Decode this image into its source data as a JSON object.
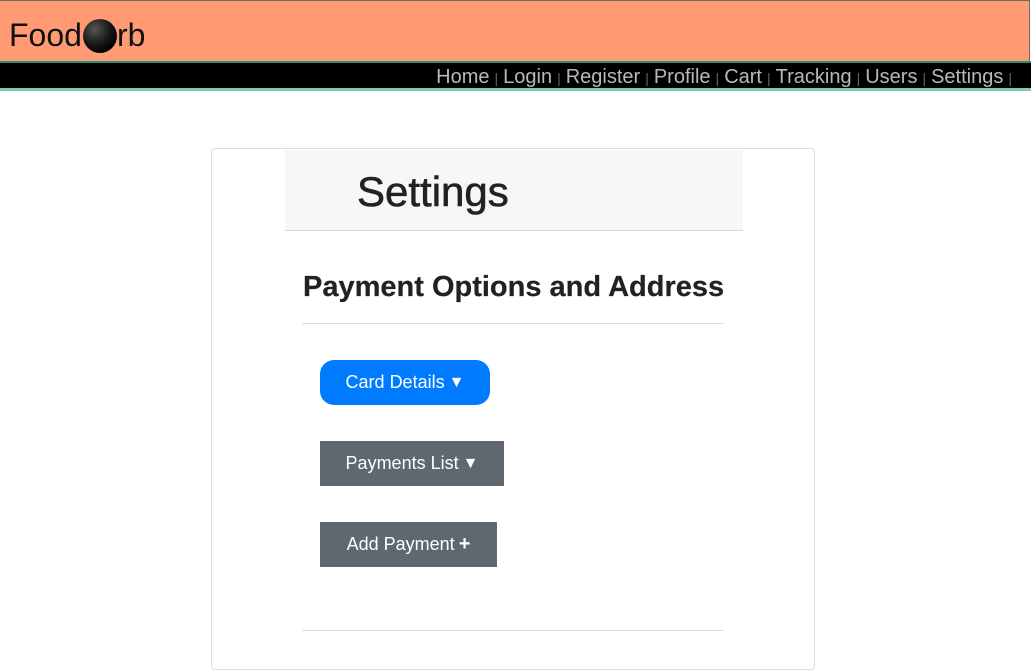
{
  "header": {
    "brand_prefix": "Food",
    "brand_suffix": "rb",
    "brand_colors": {
      "background": "#ff9a73",
      "orb": "#000000"
    }
  },
  "nav": {
    "items": [
      {
        "label": "Home"
      },
      {
        "label": "Login"
      },
      {
        "label": "Register"
      },
      {
        "label": "Profile"
      },
      {
        "label": "Cart"
      },
      {
        "label": "Tracking"
      },
      {
        "label": "Users"
      },
      {
        "label": "Settings"
      }
    ],
    "separator": "|"
  },
  "page": {
    "title": "Settings",
    "section_title": "Payment Options and Address"
  },
  "buttons": {
    "card_details": {
      "label": "Card Details",
      "icon": "▼"
    },
    "payments_list": {
      "label": "Payments List",
      "icon": "▼"
    },
    "add_payment": {
      "label": "Add Payment",
      "icon": "+"
    }
  },
  "colors": {
    "primary": "#007bff",
    "secondary": "#5f6770",
    "navbar": "#000000",
    "nav_link": "#b8b8b8"
  }
}
